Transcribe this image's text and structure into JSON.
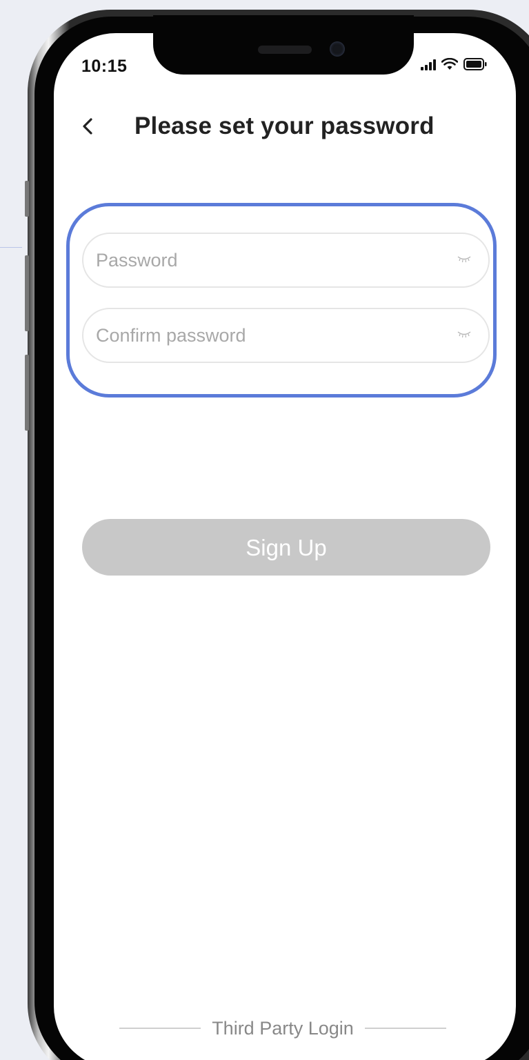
{
  "status_bar": {
    "time": "10:15",
    "icons": [
      "signal-icon",
      "wifi-icon",
      "battery-icon"
    ]
  },
  "header": {
    "back_icon": "chevron-left-icon",
    "title": "Please set your password"
  },
  "form": {
    "password": {
      "value": "",
      "placeholder": "Password",
      "toggle_icon": "eye-closed-icon"
    },
    "confirm_password": {
      "value": "",
      "placeholder": "Confirm password",
      "toggle_icon": "eye-closed-icon"
    },
    "highlight_color": "#5b7bd9"
  },
  "signup_button": {
    "label": "Sign Up",
    "color": "#c8c8c8"
  },
  "footer": {
    "third_party_label": "Third Party Login"
  }
}
